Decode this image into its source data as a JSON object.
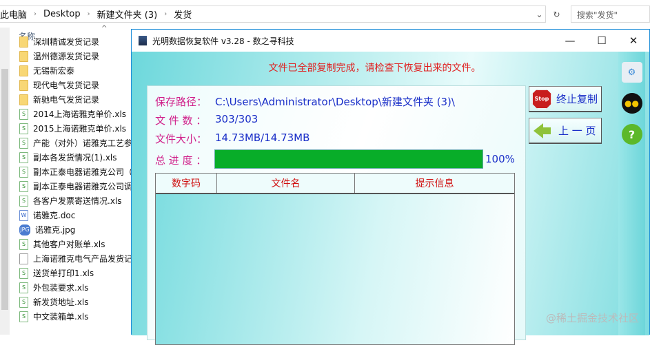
{
  "explorer": {
    "breadcrumb": [
      "此电脑",
      "Desktop",
      "新建文件夹 (3)",
      "发货"
    ],
    "search_placeholder": "搜索\"发货\"",
    "column_name": "名称",
    "files": [
      {
        "name": "深圳精诚发货记录",
        "type": "folder"
      },
      {
        "name": "温州德源发货记录",
        "type": "folder"
      },
      {
        "name": "无锡新宏泰",
        "type": "folder"
      },
      {
        "name": "现代电气发货记录",
        "type": "folder"
      },
      {
        "name": "新驰电气发货记录",
        "type": "folder"
      },
      {
        "name": "2014上海诺雅克单价.xls",
        "type": "xls"
      },
      {
        "name": "2015上海诺雅克单价.xls",
        "type": "xls"
      },
      {
        "name": "产能（对外）诺雅克工艺参",
        "type": "xls"
      },
      {
        "name": "副本各发货情况(1).xls",
        "type": "xls"
      },
      {
        "name": "副本正泰电器诺雅克公司（",
        "type": "xls"
      },
      {
        "name": "副本正泰电器诺雅克公司调",
        "type": "xls"
      },
      {
        "name": "各客户发票寄送情况.xls",
        "type": "xls"
      },
      {
        "name": "诺雅克.doc",
        "type": "doc"
      },
      {
        "name": "诺雅克.jpg",
        "type": "jpg"
      },
      {
        "name": "其他客户对账单.xls",
        "type": "xls"
      },
      {
        "name": "上海诺雅克电气产品发货记",
        "type": "file"
      },
      {
        "name": "送货单打印1.xls",
        "type": "xls"
      },
      {
        "name": "外包装要求.xls",
        "type": "xls"
      },
      {
        "name": "新发货地址.xls",
        "type": "xls"
      },
      {
        "name": "中文装箱单.xls",
        "type": "xls"
      }
    ]
  },
  "app": {
    "title": "光明数据恢复软件 v3.28 - 数之寻科技",
    "message": "文件已全部复制完成，请检查下恢复出来的文件。",
    "save_path_label": "保存路径：",
    "save_path": "C:\\Users\\Administrator\\Desktop\\新建文件夹 (3)\\",
    "file_count_label": "文 件 数 ：",
    "file_count": "303/303",
    "file_size_label": "文件大小：",
    "file_size": "14.73MB/14.73MB",
    "progress_label": "总 进 度 ：",
    "progress_percent": 100,
    "progress_text": "100%",
    "table_headers": [
      "数字码",
      "文件名",
      "提示信息"
    ],
    "stop_button": "终止复制",
    "stop_icon_text": "Stop",
    "back_button": "上 一 页",
    "colors": {
      "progress": "#08ad29",
      "message": "#e02020",
      "label": "#d0208a",
      "value": "#1a2fc8"
    }
  },
  "watermark": "@稀土掘金技术社区"
}
